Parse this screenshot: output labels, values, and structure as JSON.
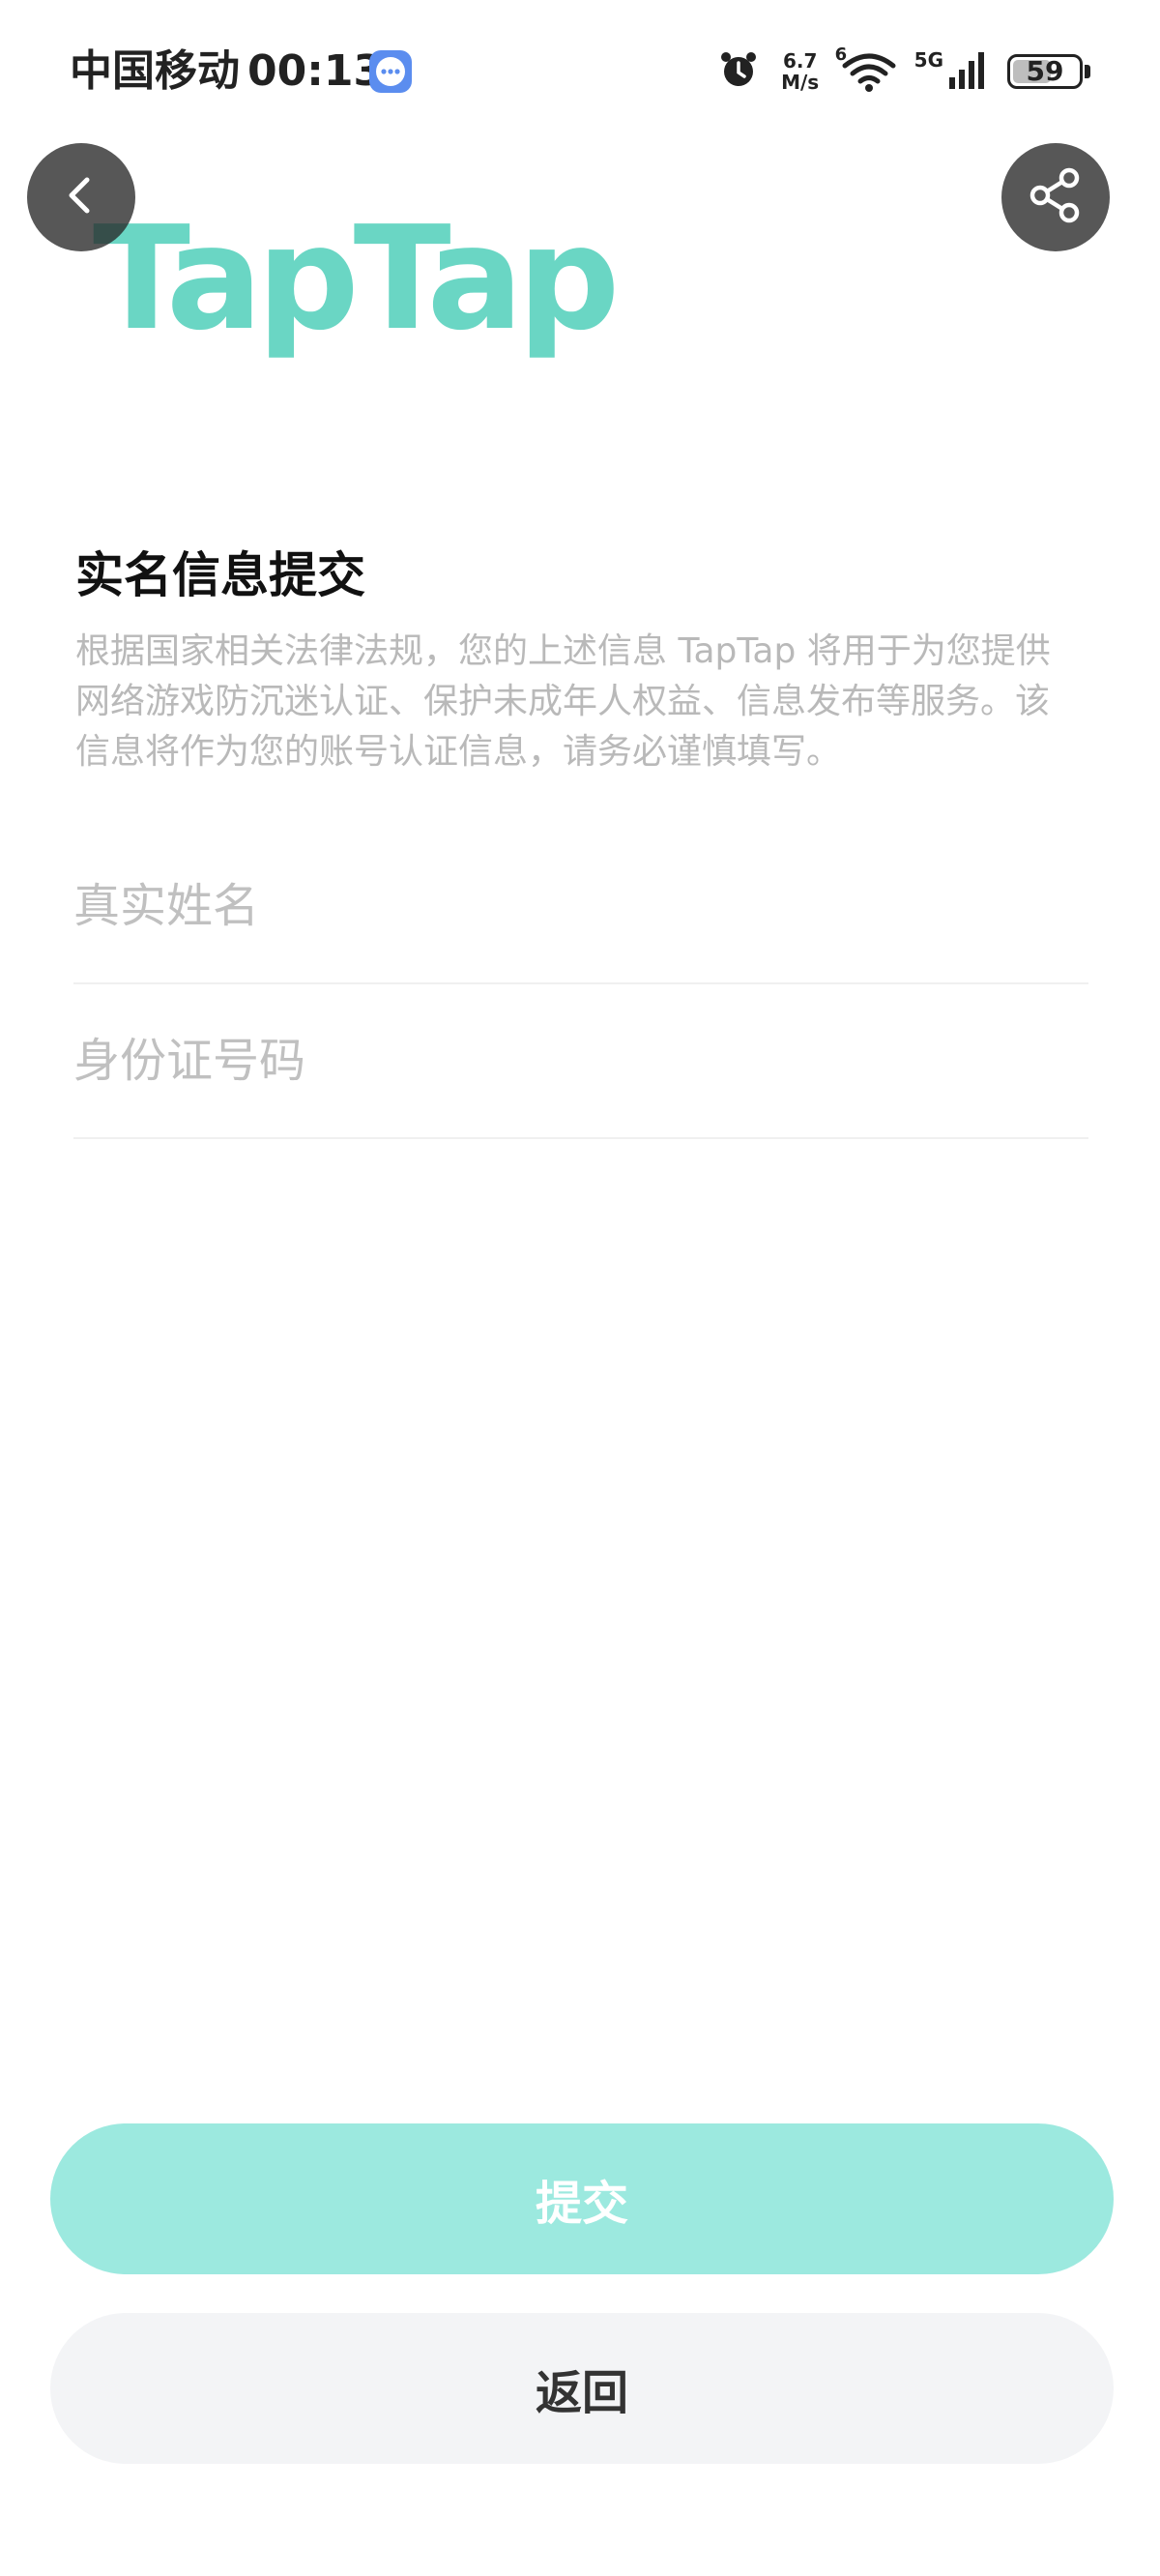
{
  "status_bar": {
    "carrier": "中国移动",
    "time": "00:13",
    "net_speed_value": "6.7",
    "net_speed_unit": "M/s",
    "wifi_badge": "6",
    "signal_label": "5G",
    "battery": "59",
    "battery_level": 0.59
  },
  "header": {
    "logo_text": "TapTap",
    "brand_color": "#6ad6c4"
  },
  "form": {
    "title": "实名信息提交",
    "description": "根据国家相关法律法规，您的上述信息 TapTap 将用于为您提供网络游戏防沉迷认证、保护未成年人权益、信息发布等服务。该信息将作为您的账号认证信息，请务必谨慎填写。",
    "name_placeholder": "真实姓名",
    "id_placeholder": "身份证号码"
  },
  "actions": {
    "submit_label": "提交",
    "back_label": "返回"
  },
  "icons": {
    "back": "chevron-left-icon",
    "share": "share-icon",
    "alarm": "alarm-icon",
    "wifi": "wifi-icon",
    "signal": "signal-icon",
    "message": "message-icon"
  }
}
